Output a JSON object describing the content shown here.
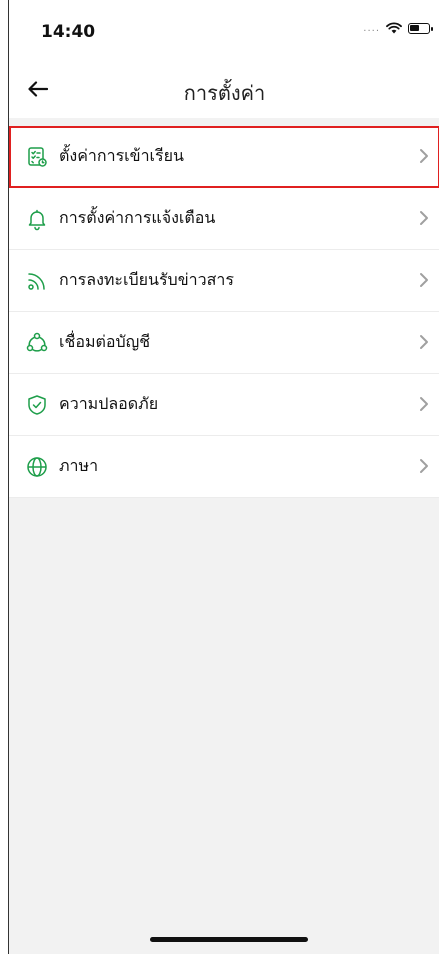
{
  "status_bar": {
    "time": "14:40",
    "signal_dots": "....",
    "wifi_icon": "wifi-icon",
    "battery_icon": "battery-icon"
  },
  "nav": {
    "title": "การตั้งค่า",
    "back_icon": "arrow-left-icon"
  },
  "menu": [
    {
      "label": "ตั้งค่าการเข้าเรียน",
      "icon": "checklist-clock-icon",
      "selected": true
    },
    {
      "label": "การตั้งค่าการแจ้งเตือน",
      "icon": "bell-icon",
      "selected": false
    },
    {
      "label": "การลงทะเบียนรับข่าวสาร",
      "icon": "rss-icon",
      "selected": false
    },
    {
      "label": "เชื่อมต่อบัญชี",
      "icon": "connected-nodes-icon",
      "selected": false
    },
    {
      "label": "ความปลอดภัย",
      "icon": "shield-check-icon",
      "selected": false
    },
    {
      "label": "ภาษา",
      "icon": "globe-icon",
      "selected": false
    }
  ],
  "colors": {
    "accent": "#1e9e4a",
    "highlight_border": "#e02020",
    "background": "#f2f2f2",
    "chevron": "#a0a0a0"
  }
}
